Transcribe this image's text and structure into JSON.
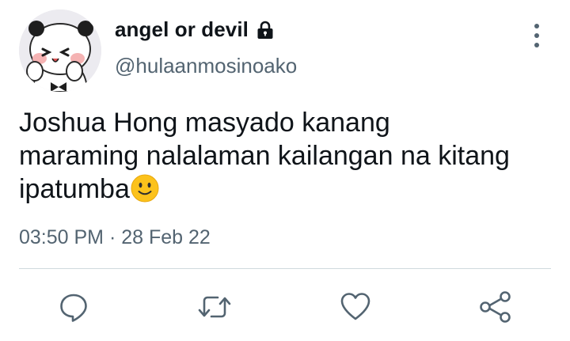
{
  "tweet": {
    "author": {
      "display_name": "angel or devil",
      "handle": "@hulaanmosinoako",
      "protected_icon": "lock-icon",
      "avatar_icon": "panda-avatar"
    },
    "text_lines": [
      "Joshua Hong masyado kanang",
      "maraming nalalaman kailangan na kitang",
      "ipatumba"
    ],
    "text_emoji": "slightly-smiling-face-emoji",
    "time": "03:50 PM",
    "separator": "·",
    "date": "28 Feb 22",
    "more_icon": "more-vertical-icon",
    "actions": [
      {
        "name": "reply",
        "icon": "reply-icon"
      },
      {
        "name": "retweet",
        "icon": "retweet-icon"
      },
      {
        "name": "like",
        "icon": "heart-icon"
      },
      {
        "name": "share",
        "icon": "share-icon"
      }
    ]
  },
  "colors": {
    "text_primary": "#0f1419",
    "text_secondary": "#536471",
    "divider": "#cfd9de",
    "emoji_yellow": "#fcc21b"
  }
}
